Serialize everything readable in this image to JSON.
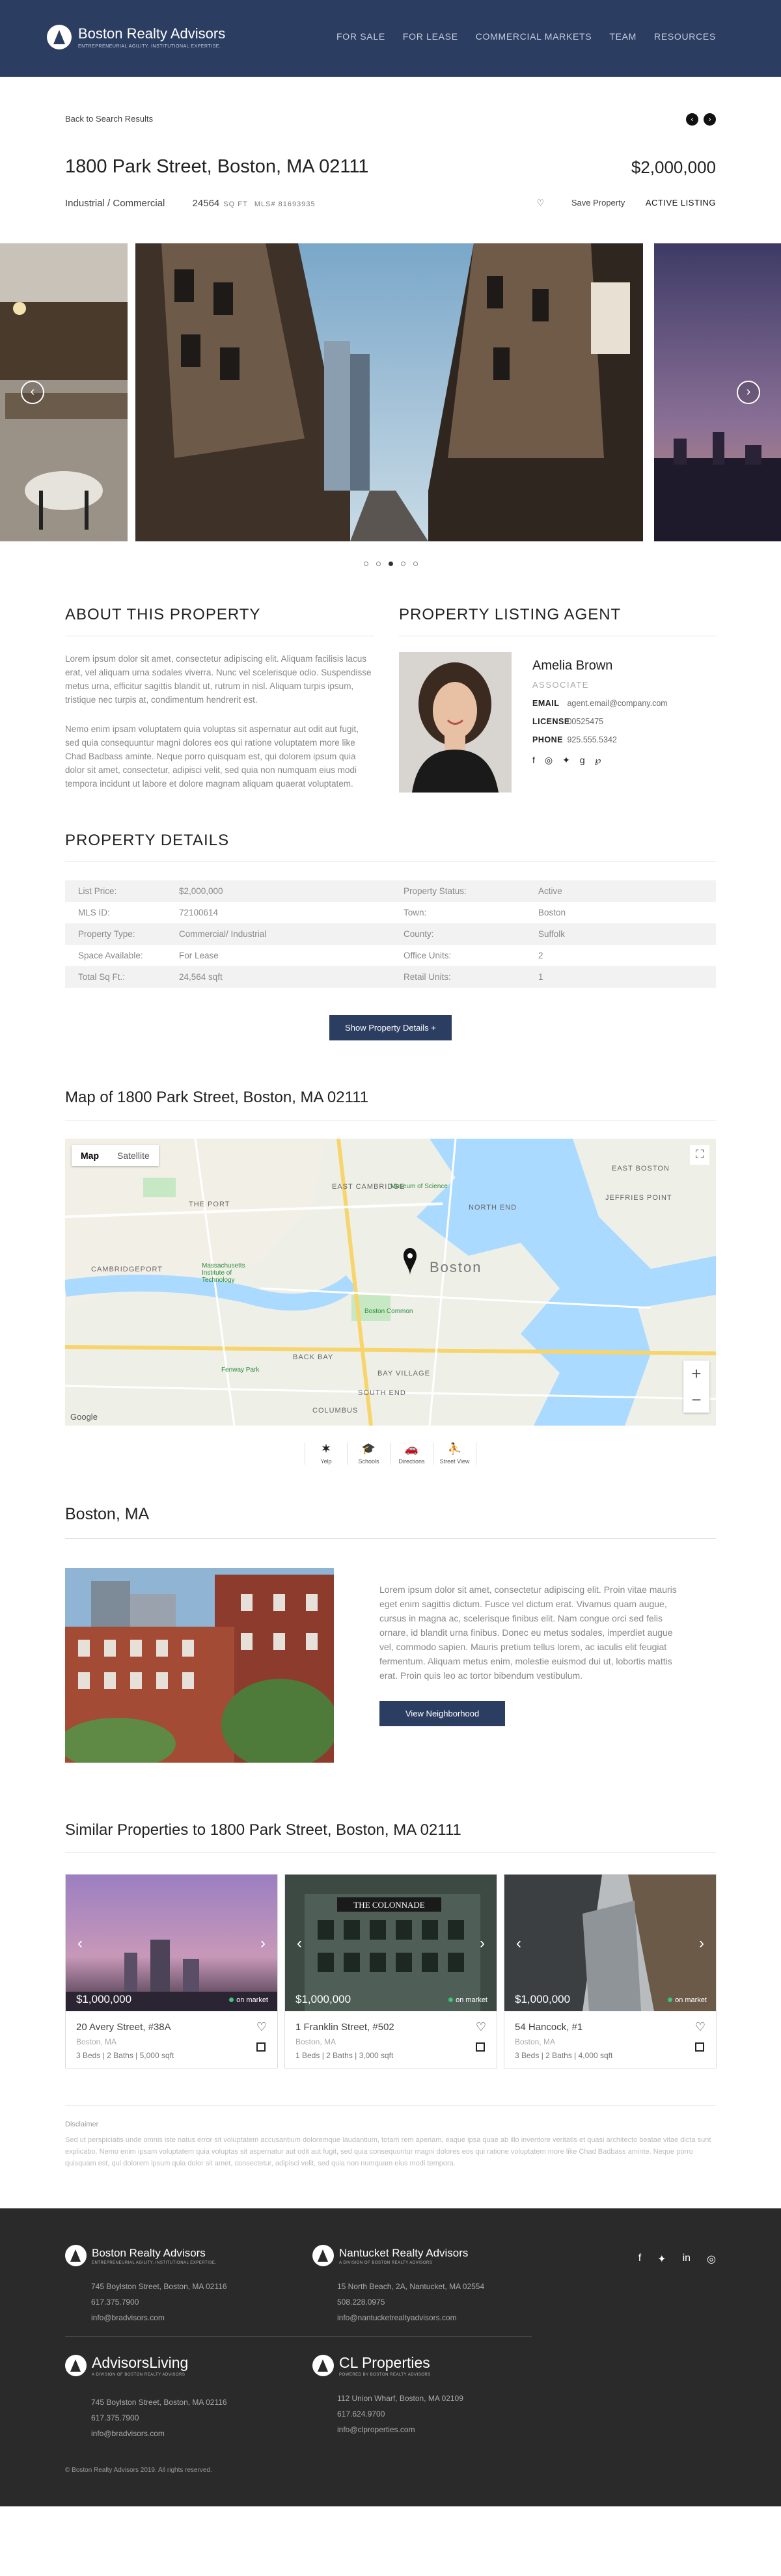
{
  "brand": {
    "name": "Boston Realty Advisors",
    "tagline": "ENTREPRENEURIAL AGILITY. INSTITUTIONAL EXPERTISE."
  },
  "nav": [
    "FOR SALE",
    "FOR LEASE",
    "COMMERCIAL MARKETS",
    "TEAM",
    "RESOURCES"
  ],
  "back": "Back to Search Results",
  "listing": {
    "title": "1800 Park Street, Boston, MA 02111",
    "price": "$2,000,000",
    "type": "Industrial / Commercial",
    "sqft": "24564",
    "sqft_unit": "SQ FT",
    "mls": "MLS# 81693935",
    "save": "Save Property",
    "status": "ACTIVE LISTING"
  },
  "about": {
    "heading": "ABOUT THIS PROPERTY",
    "p1": "Lorem ipsum dolor sit amet, consectetur adipiscing elit. Aliquam facilisis lacus erat, vel aliquam urna sodales viverra. Nunc vel scelerisque odio. Suspendisse metus urna, efficitur sagittis blandit ut, rutrum in nisl. Aliquam turpis ipsum, tristique nec turpis at, condimentum hendrerit est.",
    "p2": "Nemo enim ipsam voluptatem quia voluptas sit aspernatur aut odit aut fugit, sed quia consequuntur magni dolores eos qui ratione voluptatem more like Chad Badbass aminte. Neque porro quisquam est, qui dolorem ipsum quia dolor sit amet, consectetur, adipisci velit, sed quia non numquam eius modi tempora incidunt ut labore et dolore magnam aliquam quaerat voluptatem."
  },
  "agent": {
    "heading": "PROPERTY LISTING AGENT",
    "name": "Amelia Brown",
    "role": "ASSOCIATE",
    "email_label": "EMAIL",
    "email": "agent.email@company.com",
    "license_label": "LICENSE",
    "license": "00525475",
    "phone_label": "PHONE",
    "phone": "925.555.5342"
  },
  "details": {
    "heading": "PROPERTY DETAILS",
    "rows": [
      [
        "List Price:",
        "$2,000,000",
        "Property Status:",
        "Active"
      ],
      [
        "MLS ID:",
        "72100614",
        "Town:",
        "Boston"
      ],
      [
        "Property Type:",
        "Commercial/ Industrial",
        "County:",
        "Suffolk"
      ],
      [
        "Space Available:",
        "For Lease",
        "Office Units:",
        "2"
      ],
      [
        "Total Sq Ft.:",
        "24,564 sqft",
        "Retail Units:",
        "1"
      ]
    ],
    "button": "Show Property Details +"
  },
  "map": {
    "heading": "Map of 1800 Park Street, Boston, MA 02111",
    "tab_map": "Map",
    "tab_sat": "Satellite",
    "icons": [
      "Yelp",
      "Schools",
      "Directions",
      "Street View"
    ],
    "labels": [
      "THE PORT",
      "EAST CAMBRIDGE",
      "CAMBRIDGEPORT",
      "NORTH END",
      "EAST BOSTON",
      "Boston",
      "BACK BAY",
      "SOUTH END",
      "BAY VILLAGE",
      "COLUMBUS",
      "JEFFRIES POINT",
      "Massachusetts Institute of Technology",
      "Museum of Science",
      "Boston Common",
      "Fenway Park",
      "Google"
    ]
  },
  "neighborhood": {
    "heading": "Boston, MA",
    "text": "Lorem ipsum dolor sit amet, consectetur adipiscing elit. Proin vitae mauris eget enim sagittis dictum. Fusce vel dictum erat. Vivamus quam augue, cursus in magna ac, scelerisque finibus elit. Nam congue orci sed felis ornare, id blandit urna finibus. Donec eu metus sodales, imperdiet augue vel, commodo sapien. Mauris pretium tellus lorem, ac iaculis elit feugiat fermentum. Aliquam metus enim, molestie euismod dui ut, lobortis mattis erat. Proin quis leo ac tortor bibendum vestibulum.",
    "button": "View Neighborhood"
  },
  "similar": {
    "heading": "Similar Properties to 1800 Park Street, Boston, MA 02111",
    "cards": [
      {
        "price": "$1,000,000",
        "status": "on market",
        "address": "20 Avery Street, #38A",
        "city": "Boston, MA",
        "specs": "3 Beds  |  2 Baths  |  5,000 sqft"
      },
      {
        "price": "$1,000,000",
        "status": "on market",
        "address": "1 Franklin Street, #502",
        "city": "Boston, MA",
        "specs": "1 Beds  |  2 Baths  |  3,000 sqft"
      },
      {
        "price": "$1,000,000",
        "status": "on market",
        "address": "54 Hancock, #1",
        "city": "Boston, MA",
        "specs": "3 Beds  |  2 Baths  |  4,000 sqft"
      }
    ]
  },
  "disclaimer": {
    "label": "Disclaimer",
    "text": "Sed ut perspiciatis unde omnis iste natus error sit voluptatem accusantium doloremque laudantium, totam rem aperiam, eaque ipsa quae ab illo inventore veritatis et quasi architecto beatae vitae dicta sunt explicabo. Nemo enim ipsam voluptatem quia voluptas sit aspernatur aut odit aut fugit, sed quia consequuntur magni dolores eos qui ratione voluptatem more like Chad Badbass aminte. Neque porro quisquam est, qui dolorem ipsum quia dolor sit amet, consectetur, adipisci velit, sed quia non numquam eius modi tempora."
  },
  "footer": {
    "bra": {
      "name": "Boston Realty Advisors",
      "sub": "ENTREPRENEURIAL AGILITY. INSTITUTIONAL EXPERTISE.",
      "addr": "745 Boylston Street, Boston, MA 02116",
      "phone": "617.375.7900",
      "email": "info@bradvisors.com"
    },
    "nan": {
      "name": "Nantucket Realty Advisors",
      "sub": "A DIVISION OF BOSTON REALTY ADVISORS",
      "addr": "15 North Beach, 2A, Nantucket, MA 02554",
      "phone": "508.228.0975",
      "email": "info@nantucketrealtyadvisors.com"
    },
    "liv": {
      "name": "AdvisorsLiving",
      "sub": "A DIVISION OF BOSTON REALTY ADVISORS",
      "addr": "745 Boylston Street, Boston, MA 02116",
      "phone": "617.375.7900",
      "email": "info@bradvisors.com"
    },
    "clp": {
      "name": "CL Properties",
      "sub": "POWERED BY BOSTON REALTY ADVISORS",
      "addr": "112 Union Wharf, Boston, MA 02109",
      "phone": "617.624.9700",
      "email": "info@clproperties.com"
    },
    "copyright": "© Boston Realty Advisors 2019. All rights reserved."
  }
}
